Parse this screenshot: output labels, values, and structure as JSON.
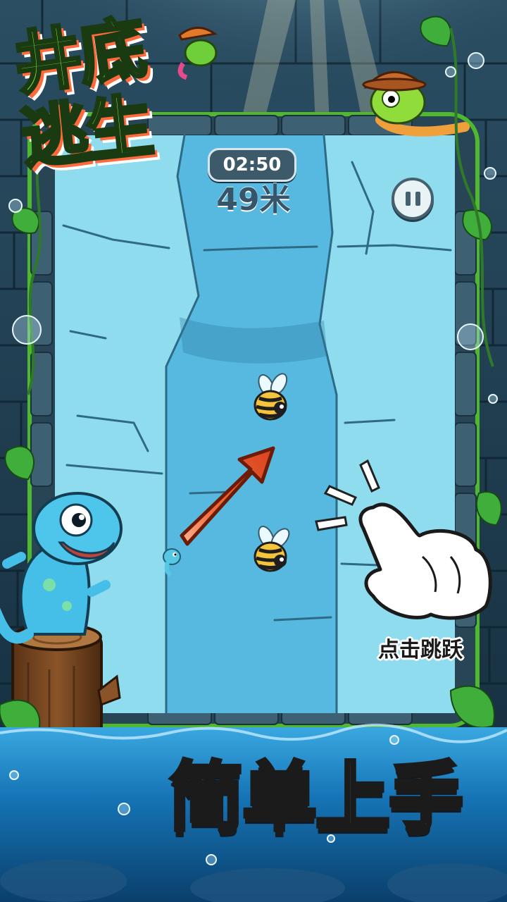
{
  "title": {
    "line1": "井底",
    "line2": "逃生"
  },
  "hud": {
    "timer": "02:50",
    "distance": "49米"
  },
  "tutorial": {
    "tap_label": "点击跳跃"
  },
  "slogan": "简单上手",
  "colors": {
    "well_stone": "#1f3a4c",
    "well_frame_border": "#4fb82e",
    "play_area": "#7fd3ea",
    "title_green": "#8ee63c",
    "arrow_orange": "#e8522a",
    "water": "#1673b5"
  },
  "icons": [
    "pause-icon",
    "tap-hand-icon",
    "bee-icon",
    "arrow-icon",
    "bubble-icon",
    "leaf-icon"
  ]
}
